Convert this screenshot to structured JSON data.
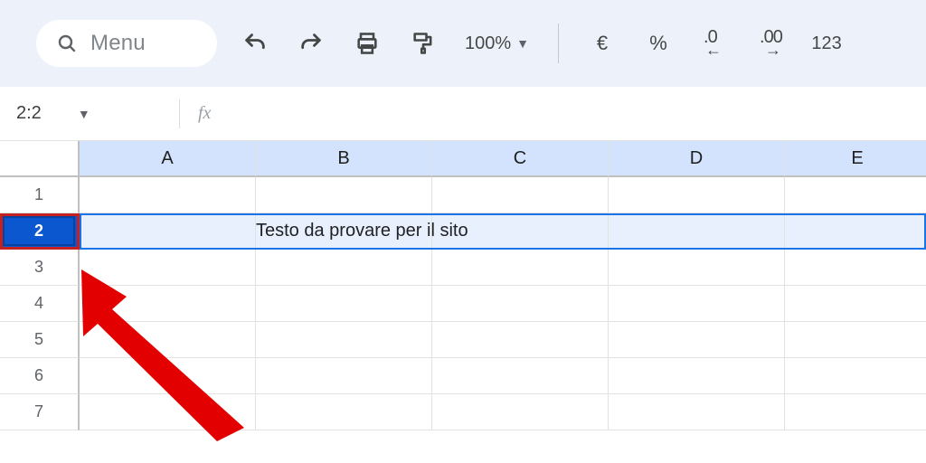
{
  "toolbar": {
    "menu_placeholder": "Menu",
    "zoom": "100%",
    "currency": "€",
    "percent": "%",
    "dec_decrease": ".0",
    "dec_increase": ".00",
    "numfmt": "123"
  },
  "formula_bar": {
    "name_box": "2:2",
    "fx_symbol": "fx"
  },
  "columns": [
    "A",
    "B",
    "C",
    "D",
    "E"
  ],
  "rows": [
    "1",
    "2",
    "3",
    "4",
    "5",
    "6",
    "7"
  ],
  "selected_row_index": 1,
  "cells": {
    "B2": "Testo da provare per il sito"
  }
}
